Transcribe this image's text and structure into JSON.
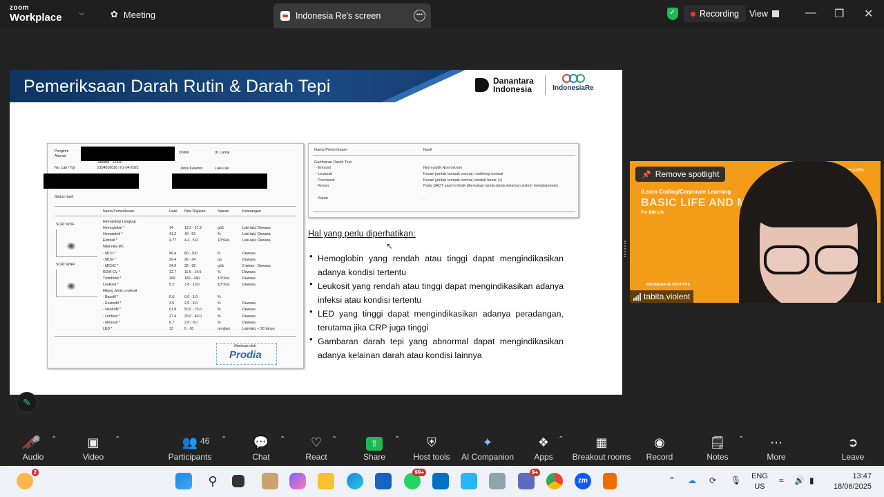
{
  "titlebar": {
    "app_top": "zoom",
    "app_bottom": "Workplace",
    "meeting_label": "Meeting",
    "tab_label": "Indonesia Re's screen",
    "recording_label": "Recording",
    "view_label": "View"
  },
  "slide": {
    "title": "Pemeriksaan Darah Rutin & Darah Tepi",
    "logo_left_line1": "Danantara",
    "logo_left_line2": "Indonesia",
    "logo_right": "IndonesiaRe",
    "notes_heading": "Hal yang perlu diperhatikan:",
    "notes": [
      "Hemoglobin yang rendah atau tinggi dapat mengindikasikan adanya kondisi tertentu",
      "Leukosit yang rendah atau tinggi dapat mengindikasikan adanya infeksi atau kondisi tertentu",
      "LED yang tinggi dapat mengindikasikan adanya peradangan, terutama jika CRP juga tinggi",
      "Gambaran darah tepi yang abnormal dapat mengindikasikan adanya kelainan darah atau kondisi lainnya"
    ]
  },
  "report": {
    "pengirim": "Pengirim",
    "alamat": "Alamat",
    "alamat_val": "Jakarta - 12930",
    "nolab": "No. Lab / Tgl",
    "nolab_val": "2104010016 / 01-04-2021",
    "dokter": "Dokter",
    "dokter_val": "dr. Lanny",
    "jk": "Jenis Kelamin",
    "jk_val": "Laki-Laki",
    "status": "Status hasil",
    "col_nama": "Nama Pemeriksaan",
    "col_hasil": "Hasil",
    "col_rujukan": "Nilai Rujukan",
    "col_satuan": "Satuan",
    "col_ket": "Keterangan",
    "scat1": "SCAT WDF",
    "scat2": "SCAT WNR",
    "rows": [
      [
        "Hematologi Lengkap",
        "",
        "",
        "",
        ""
      ],
      [
        "Hemoglobin *",
        "14",
        "13.2 - 17.3",
        "g/dL",
        "Laki-laki, Dewasa"
      ],
      [
        "Hematokrit *",
        "41.2",
        "40 - 52",
        "%",
        "Laki-laki, Dewasa"
      ],
      [
        "Eritrosit *",
        "4.77",
        "4.4 - 5.9",
        "10^6/uL",
        "Laki-laki, Dewasa"
      ],
      [
        "Nilai-nilai MC",
        "",
        "",
        "",
        ""
      ],
      [
        "- MCV *",
        "86.4",
        "80 - 100",
        "fL",
        "Dewasa"
      ],
      [
        "- MCH *",
        "29.4",
        "26 - 34",
        "pg",
        "Dewasa"
      ],
      [
        "- MCHC *",
        "34.0",
        "32 - 36",
        "g/dL",
        "5 tahun - Dewasa"
      ],
      [
        "RDW-CV *",
        "12.7",
        "11.5 - 14.5",
        "%",
        "Dewasa"
      ],
      [
        "Trombosit *",
        "269",
        "150 - 440",
        "10^3/uL",
        "Dewasa"
      ],
      [
        "Leukosit *",
        "5.2",
        "3.8 - 10.6",
        "10^3/uL",
        "Dewasa"
      ],
      [
        "Hitung Jenis Leukosit",
        "",
        "",
        "",
        ""
      ],
      [
        "- Basofil *",
        "0.6",
        "0.0 - 1.0",
        "%",
        ""
      ],
      [
        "- Eosinofil *",
        "3.5",
        "2.0 - 4.0",
        "%",
        "Dewasa"
      ],
      [
        "- Neutrofil *",
        "61.8",
        "50.0 - 70.0",
        "%",
        "Dewasa"
      ],
      [
        "- Limfosit *",
        "27.4",
        "25.0 - 40.0",
        "%",
        "Dewasa"
      ],
      [
        "- Monosit *",
        "6.7",
        "2.0 - 8.0",
        "%",
        "Dewasa"
      ],
      [
        "LED *",
        "13",
        "0 - 20",
        "mm/jam",
        "Laki-laki, < 50 tahun"
      ]
    ],
    "otorisasi": "Otorisasi oleh",
    "stamp": "Prodia"
  },
  "smear": {
    "col_nama": "Nama Pemeriksaan",
    "col_hasil": "Hasil",
    "group": "Gambaran Darah Tepi",
    "rows": [
      [
        "- Eritrosit",
        "Normositik Normokrom"
      ],
      [
        "- Leukosit",
        "Kesan jumlah tampak normal, morfologi normal"
      ],
      [
        "- Trombosit",
        "Kesan jumlah tampak normal, bentuk besar (+)"
      ],
      [
        "- Kesan",
        "Pada SADT saat ini tidak ditemukan tanda-tanda kelainan sistem hematopoiesis"
      ],
      [
        "- Saran",
        "-"
      ]
    ]
  },
  "video": {
    "spotlight_btn": "Remove spotlight",
    "participant_name": "tabita.violent",
    "bg_line1": "iLearn Coding/Corporate Learning",
    "bg_line2": "BASIC LIFE AND MI",
    "bg_line3": "For BNI Life",
    "bg_logo": "IndonesiaRe",
    "bg_footer": "INDONESIA RE INSTITUTE"
  },
  "toolbar": {
    "audio": "Audio",
    "video": "Video",
    "participants": "Participants",
    "participants_count": "46",
    "chat": "Chat",
    "react": "React",
    "share": "Share",
    "host_tools": "Host tools",
    "ai_companion": "AI Companion",
    "apps": "Apps",
    "breakout": "Breakout rooms",
    "record": "Record",
    "notes": "Notes",
    "more": "More",
    "leave": "Leave"
  },
  "taskbar": {
    "left_badge": "2",
    "whatsapp_badge": "99+",
    "teams_badge": "9+",
    "lang_top": "ENG",
    "lang_bottom": "US",
    "time": "13:47",
    "date": "18/06/2025"
  },
  "colors": {
    "slide_header": "#1a4a83",
    "video_bg": "#f39c1a",
    "share_green": "#1db954",
    "recording_red": "#e53935"
  }
}
